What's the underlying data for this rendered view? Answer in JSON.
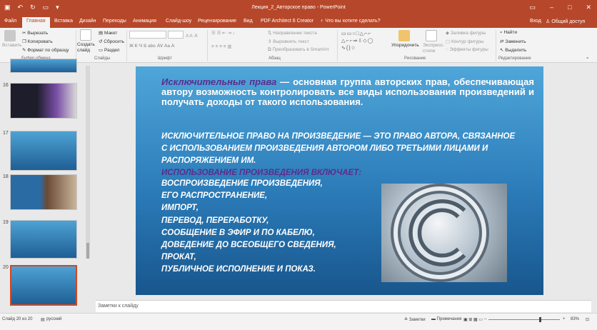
{
  "window": {
    "title": "Лекция_2_Авторское право - PowerPoint",
    "login": "Вход",
    "share": "Общий доступ"
  },
  "tabs": [
    {
      "label": "Файл"
    },
    {
      "label": "Главная"
    },
    {
      "label": "Вставка"
    },
    {
      "label": "Дизайн"
    },
    {
      "label": "Переходы"
    },
    {
      "label": "Анимация"
    },
    {
      "label": "Слайд-шоу"
    },
    {
      "label": "Рецензирование"
    },
    {
      "label": "Вид"
    },
    {
      "label": "PDF Architect 6 Creator"
    },
    {
      "label": "Что вы хотите сделать?"
    }
  ],
  "ribbon": {
    "paste": "Вставить",
    "cut": "Вырезать",
    "copy": "Копировать",
    "format_painter": "Формат по образцу",
    "create_slide": "Создать слайд",
    "layout": "Макет",
    "reset": "Сбросить",
    "section": "Раздел",
    "font_size_value": "",
    "text_direction": "Направление текста",
    "align_text": "Выровнять текст",
    "smartart": "Преобразовать в SmartArt",
    "arrange": "Упорядочить",
    "quick_styles": "Экспресс-стили",
    "shape_fill": "Заливка фигуры",
    "shape_outline": "Контур фигуры",
    "shape_effects": "Эффекты фигуры",
    "find": "Найти",
    "replace": "Заменить",
    "select": "Выделить",
    "groups": {
      "clipboard": "Буфер обмена",
      "slides": "Слайды",
      "font": "Шрифт",
      "paragraph": "Абзац",
      "drawing": "Рисование",
      "editing": "Редактирование"
    }
  },
  "thumbnails": [
    {
      "num": ""
    },
    {
      "num": "16"
    },
    {
      "num": "17"
    },
    {
      "num": "18"
    },
    {
      "num": "19"
    },
    {
      "num": "20"
    }
  ],
  "slide": {
    "p1_highlight": "Исключительные права",
    "p1_rest": " — основная группа авторских прав, обеспечивающая автору возможность контролировать все виды использования произведений и получать доходы от такого использования.",
    "p2": "ИСКЛЮЧИТЕЛЬНОЕ ПРАВО НА ПРОИЗВЕДЕНИЕ — ЭТО ПРАВО АВТОРА, СВЯЗАННОЕ С ИСПОЛЬЗОВАНИЕМ ПРОИЗВЕДЕНИЯ АВТОРОМ ЛИБО ТРЕТЬИМИ ЛИЦАМИ И РАСПОРЯЖЕНИЕМ ИМ.",
    "p3": "ИСПОЛЬЗОВАНИЕ ПРОИЗВЕДЕНИЯ ВКЛЮЧАЕТ:",
    "list": [
      "ВОСПРОИЗВЕДЕНИЕ ПРОИЗВЕДЕНИЯ,",
      "ЕГО РАСПРОСТРАНЕНИЕ,",
      "ИМПОРТ,",
      "ПЕРЕВОД, ПЕРЕРАБОТКУ,",
      "СООБЩЕНИЕ В ЭФИР И ПО КАБЕЛЮ,",
      "ДОВЕДЕНИЕ ДО ВСЕОБЩЕГО СВЕДЕНИЯ,",
      "ПРОКАТ,",
      "ПУБЛИЧНОЕ ИСПОЛНЕНИЕ И ПОКАЗ."
    ]
  },
  "notes_placeholder": "Заметки к слайду",
  "status": {
    "slide": "Слайд 20 из 20",
    "lang": "русский",
    "notes": "Заметки",
    "comments": "Примечания",
    "zoom": "83%"
  },
  "colors": {
    "accent": "#b7472a",
    "slide_highlight": "#5b2d8e"
  }
}
